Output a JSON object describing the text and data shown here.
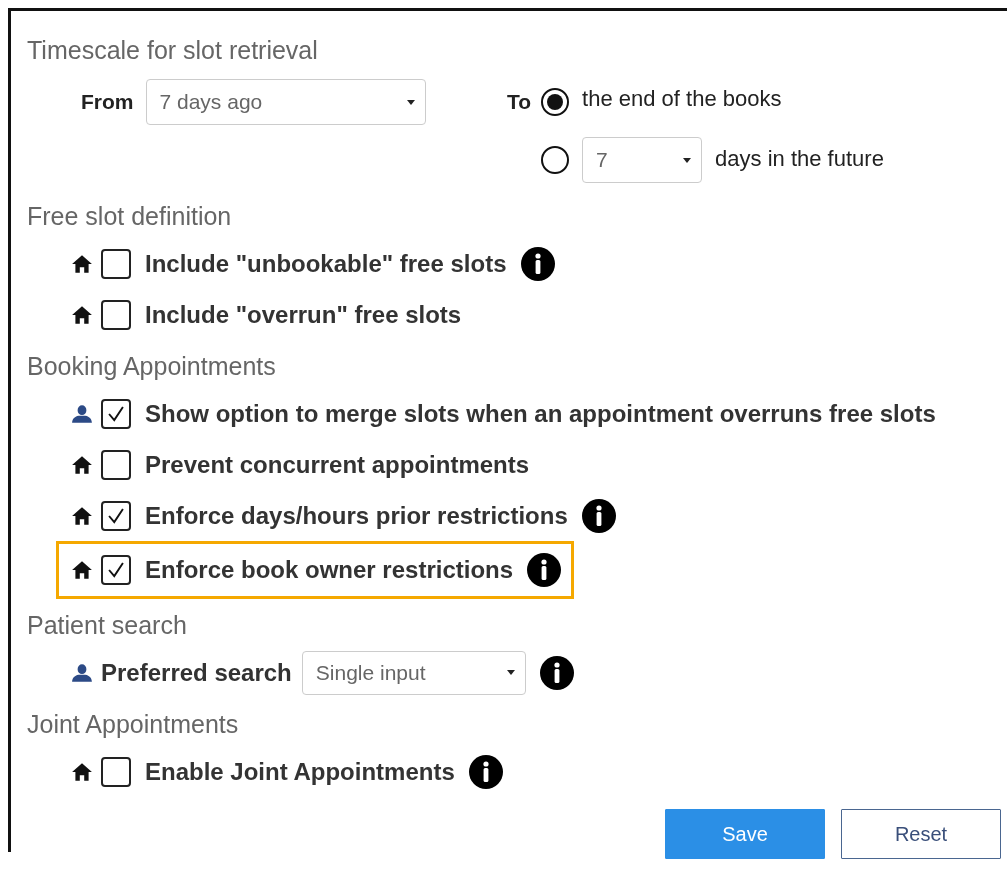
{
  "timescale": {
    "heading": "Timescale for slot retrieval",
    "from": {
      "label": "From",
      "value": "7 days ago"
    },
    "to": {
      "label": "To",
      "options": [
        {
          "kind": "text",
          "label": "the end of the books",
          "selected": true
        },
        {
          "kind": "dropdown",
          "value": "7",
          "suffix": "days in the future",
          "selected": false
        }
      ]
    }
  },
  "sections": [
    {
      "heading": "Free slot definition",
      "items": [
        {
          "kind": "checkbox",
          "user_setting": false,
          "checked": false,
          "label": "Include \"unbookable\" free slots",
          "info": true,
          "highlighted": false
        },
        {
          "kind": "checkbox",
          "user_setting": false,
          "checked": false,
          "label": "Include \"overrun\" free slots",
          "info": false,
          "highlighted": false
        }
      ]
    },
    {
      "heading": "Booking Appointments",
      "items": [
        {
          "kind": "checkbox",
          "user_setting": true,
          "checked": true,
          "label": "Show option to merge slots when an appointment overruns free slots",
          "info": false,
          "highlighted": false
        },
        {
          "kind": "checkbox",
          "user_setting": false,
          "checked": false,
          "label": "Prevent concurrent appointments",
          "info": false,
          "highlighted": false
        },
        {
          "kind": "checkbox",
          "user_setting": false,
          "checked": true,
          "label": "Enforce days/hours prior restrictions",
          "info": true,
          "highlighted": false
        },
        {
          "kind": "checkbox",
          "user_setting": false,
          "checked": true,
          "label": "Enforce book owner restrictions",
          "info": true,
          "highlighted": true
        }
      ]
    },
    {
      "heading": "Patient search",
      "items": [
        {
          "kind": "select",
          "user_setting": true,
          "label": "Preferred search",
          "value": "Single input",
          "info": true,
          "highlighted": false
        }
      ]
    },
    {
      "heading": "Joint Appointments",
      "items": [
        {
          "kind": "checkbox",
          "user_setting": false,
          "checked": false,
          "label": "Enable Joint Appointments",
          "info": true,
          "highlighted": false
        }
      ]
    }
  ],
  "buttons": [
    {
      "label": "Save",
      "kind": "primary"
    },
    {
      "label": "Reset",
      "kind": "secondary"
    }
  ]
}
